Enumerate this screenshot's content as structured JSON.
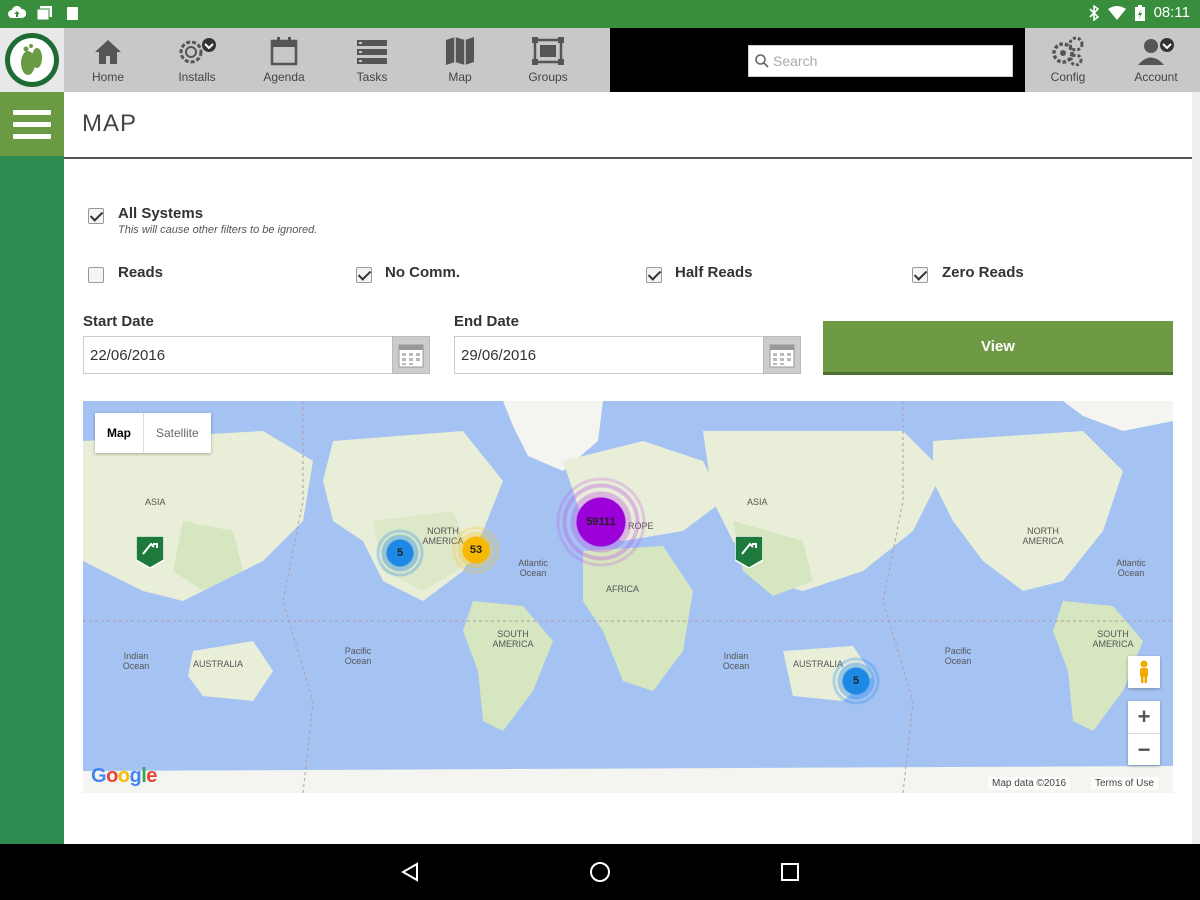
{
  "status_bar": {
    "time": "08:11"
  },
  "nav": {
    "items": [
      {
        "label": "Home",
        "icon": "home-icon"
      },
      {
        "label": "Installs",
        "icon": "installs-gear-icon"
      },
      {
        "label": "Agenda",
        "icon": "calendar-icon"
      },
      {
        "label": "Tasks",
        "icon": "tasks-icon"
      },
      {
        "label": "Map",
        "icon": "map-icon"
      },
      {
        "label": "Groups",
        "icon": "groups-icon"
      }
    ],
    "search_placeholder": "Search",
    "config_label": "Config",
    "account_label": "Account"
  },
  "page": {
    "title": "MAP"
  },
  "filters": {
    "all_systems": {
      "label": "All Systems",
      "checked": true,
      "hint": "This will cause other filters to be ignored."
    },
    "reads": {
      "label": "Reads",
      "checked": false
    },
    "no_comm": {
      "label": "No Comm.",
      "checked": true
    },
    "half_reads": {
      "label": "Half Reads",
      "checked": true
    },
    "zero_reads": {
      "label": "Zero Reads",
      "checked": true
    }
  },
  "dates": {
    "start_label": "Start Date",
    "start_value": "22/06/2016",
    "end_label": "End Date",
    "end_value": "29/06/2016"
  },
  "view_button": "View",
  "map": {
    "toggle_map": "Map",
    "toggle_satellite": "Satellite",
    "clusters": {
      "europe": "59111",
      "us_east": "53",
      "us_west": "5",
      "australia": "5"
    },
    "labels": {
      "asia_left": "ASIA",
      "asia_right": "ASIA",
      "north_america": "NORTH AMERICA",
      "north_america_right": "NORTH AMERICA",
      "europe": "ROPE",
      "africa": "AFRICA",
      "south_america": "SOUTH AMERICA",
      "south_america_right": "SOUTH AMERICA",
      "australia_left": "AUSTRALIA",
      "australia_right": "AUSTRALIA",
      "atlantic": "Atlantic Ocean",
      "atlantic_right": "Atlantic Ocean",
      "indian_left": "Indian Ocean",
      "indian_right": "Indian Ocean",
      "pacific_left": "Pacific Ocean",
      "pacific_right": "Pacific Ocean"
    },
    "zoom_in": "+",
    "zoom_out": "−",
    "credit": "Map data ©2016",
    "terms": "Terms of Use",
    "google": "Google"
  },
  "colors": {
    "status_green": "#388e3c",
    "sidebar_green": "#2e8b50",
    "accent_green": "#6f9a45",
    "cluster_purple": "#9b00d9",
    "cluster_yellow": "#f6b800",
    "cluster_blue": "#1e88e5"
  }
}
